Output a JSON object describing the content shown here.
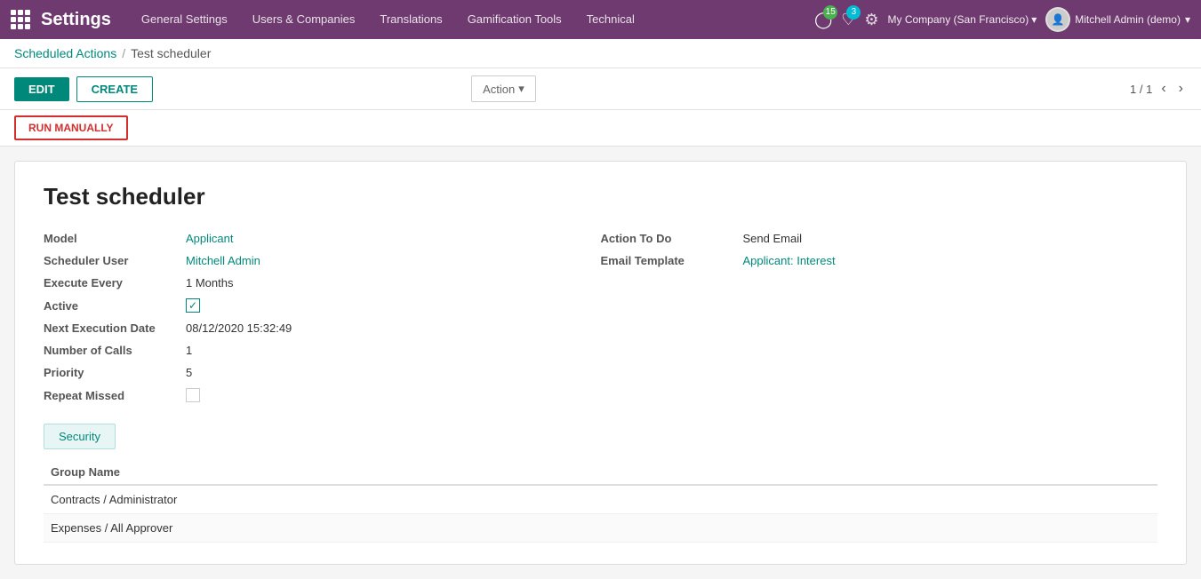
{
  "navbar": {
    "title": "Settings",
    "menu_items": [
      "General Settings",
      "Users & Companies",
      "Translations",
      "Gamification Tools",
      "Technical"
    ],
    "clock_badge": "15",
    "chat_badge": "3",
    "company": "My Company (San Francisco)",
    "user": "Mitchell Admin (demo)"
  },
  "breadcrumb": {
    "parent": "Scheduled Actions",
    "separator": "/",
    "current": "Test scheduler"
  },
  "toolbar": {
    "edit_label": "EDIT",
    "create_label": "CREATE",
    "action_label": "Action",
    "pager_current": "1",
    "pager_total": "1"
  },
  "toolbar2": {
    "run_manually_label": "RUN MANUALLY"
  },
  "record": {
    "title": "Test scheduler",
    "fields": {
      "model_label": "Model",
      "model_value": "Applicant",
      "scheduler_user_label": "Scheduler User",
      "scheduler_user_value": "Mitchell Admin",
      "execute_every_label": "Execute Every",
      "execute_every_value": "1 Months",
      "active_label": "Active",
      "active_checked": true,
      "next_execution_label": "Next Execution Date",
      "next_execution_value": "08/12/2020 15:32:49",
      "number_calls_label": "Number of Calls",
      "number_calls_value": "1",
      "priority_label": "Priority",
      "priority_value": "5",
      "repeat_missed_label": "Repeat Missed",
      "repeat_missed_checked": false,
      "action_to_do_label": "Action To Do",
      "action_to_do_value": "Send Email",
      "email_template_label": "Email Template",
      "email_template_value": "Applicant: Interest"
    }
  },
  "security": {
    "tab_label": "Security",
    "group_name_header": "Group Name",
    "groups": [
      "Contracts / Administrator",
      "Expenses / All Approver"
    ]
  }
}
